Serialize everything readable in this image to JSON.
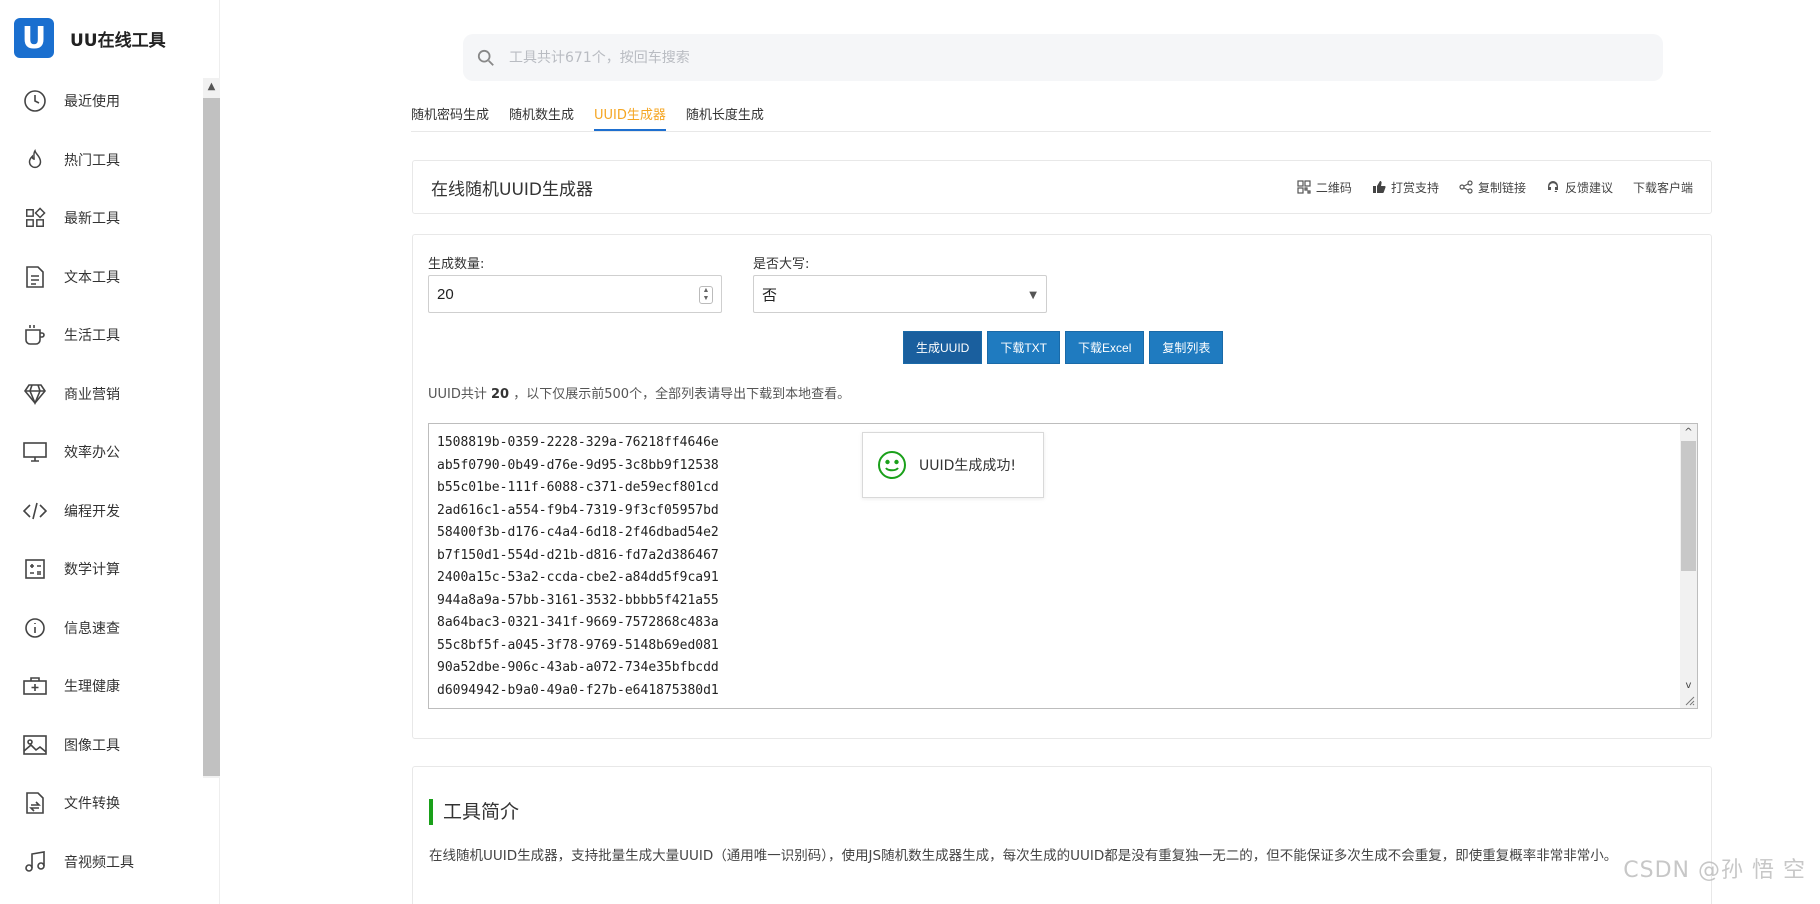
{
  "brand": {
    "logo_letter": "U",
    "name": "UU在线工具"
  },
  "sidebar": {
    "items": [
      {
        "label": "最近使用",
        "icon": "clock-icon"
      },
      {
        "label": "热门工具",
        "icon": "fire-icon"
      },
      {
        "label": "最新工具",
        "icon": "grid-icon"
      },
      {
        "label": "文本工具",
        "icon": "document-icon"
      },
      {
        "label": "生活工具",
        "icon": "cup-icon"
      },
      {
        "label": "商业营销",
        "icon": "diamond-icon"
      },
      {
        "label": "效率办公",
        "icon": "monitor-icon"
      },
      {
        "label": "编程开发",
        "icon": "code-icon"
      },
      {
        "label": "数学计算",
        "icon": "math-icon"
      },
      {
        "label": "信息速查",
        "icon": "info-icon"
      },
      {
        "label": "生理健康",
        "icon": "health-icon"
      },
      {
        "label": "图像工具",
        "icon": "image-icon"
      },
      {
        "label": "文件转换",
        "icon": "file-icon"
      },
      {
        "label": "音视频工具",
        "icon": "music-icon"
      }
    ]
  },
  "search": {
    "placeholder": "工具共计671个，按回车搜索"
  },
  "tabs": [
    {
      "label": "随机密码生成",
      "active": false
    },
    {
      "label": "随机数生成",
      "active": false
    },
    {
      "label": "UUID生成器",
      "active": true
    },
    {
      "label": "随机长度生成",
      "active": false
    }
  ],
  "header": {
    "title": "在线随机UUID生成器",
    "actions": [
      {
        "label": "二维码",
        "icon": "qrcode-icon"
      },
      {
        "label": "打赏支持",
        "icon": "thumbs-up-icon"
      },
      {
        "label": "复制链接",
        "icon": "share-icon"
      },
      {
        "label": "反馈建议",
        "icon": "headset-icon"
      },
      {
        "label": "下载客户端",
        "icon": ""
      }
    ]
  },
  "form": {
    "count_label": "生成数量:",
    "count_value": "20",
    "upper_label": "是否大写:",
    "upper_value": "否",
    "buttons": {
      "generate": "生成UUID",
      "download_txt": "下载TXT",
      "download_excel": "下载Excel",
      "copy_list": "复制列表"
    },
    "info_prefix": "UUID共计",
    "info_count": "20",
    "info_suffix": "，以下仅展示前500个，全部列表请导出下载到本地查看。"
  },
  "uuids": [
    "1508819b-0359-2228-329a-76218ff4646e",
    "ab5f0790-0b49-d76e-9d95-3c8bb9f12538",
    "b55c01be-111f-6088-c371-de59ecf801cd",
    "2ad616c1-a554-f9b4-7319-9f3cf05957bd",
    "58400f3b-d176-c4a4-6d18-2f46dbad54e2",
    "b7f150d1-554d-d21b-d816-fd7a2d386467",
    "2400a15c-53a2-ccda-cbe2-a84dd5f9ca91",
    "944a8a9a-57bb-3161-3532-bbbb5f421a55",
    "8a64bac3-0321-341f-9669-7572868c483a",
    "55c8bf5f-a045-3f78-9769-5148b69ed081",
    "90a52dbe-906c-43ab-a072-734e35bfbcdd",
    "d6094942-b9a0-49a0-f27b-e641875380d1"
  ],
  "toast": {
    "text": "UUID生成成功!",
    "icon": "smiley-icon"
  },
  "intro": {
    "title": "工具简介",
    "text": "在线随机UUID生成器，支持批量生成大量UUID（通用唯一识别码），使用JS随机数生成器生成，每次生成的UUID都是没有重复独一无二的，但不能保证多次生成不会重复，即使重复概率非常非常小。"
  },
  "watermark": "CSDN @孙 悟 空",
  "colors": {
    "brand": "#1a6fcf",
    "tab_active": "#f5a623",
    "button": "#1f7bc0",
    "intro_accent": "#1aa01a",
    "toast_icon": "#1aa01a"
  }
}
